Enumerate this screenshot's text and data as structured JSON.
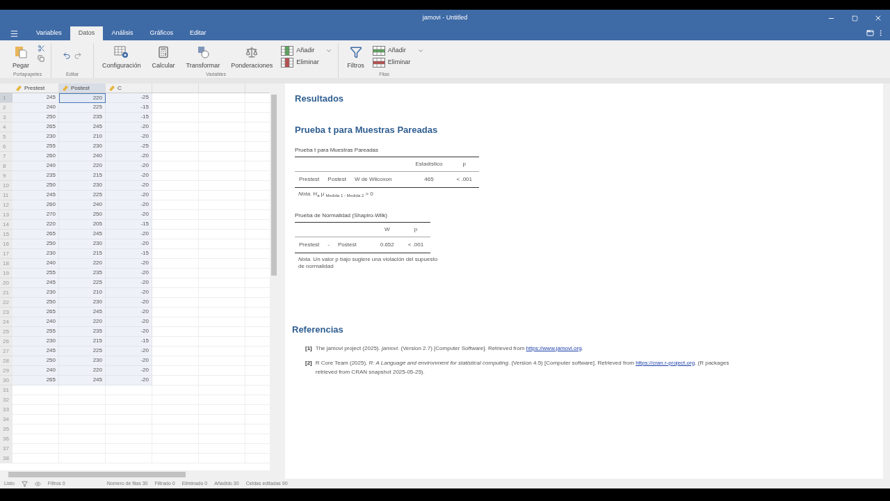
{
  "window": {
    "title": "jamovi - Untitled"
  },
  "tabs": [
    {
      "label": "Variables",
      "selected": false
    },
    {
      "label": "Datos",
      "selected": true
    },
    {
      "label": "Análisis",
      "selected": false
    },
    {
      "label": "Gráficos",
      "selected": false
    },
    {
      "label": "Editar",
      "selected": false
    }
  ],
  "ribbon": {
    "clipboard": {
      "label": "Portapapeles",
      "paste": "Pegar"
    },
    "edit": {
      "label": "Editar"
    },
    "variables": {
      "label": "Variables",
      "setup": "Configuración",
      "compute": "Calcular",
      "transform": "Transformar",
      "weights": "Ponderaciones",
      "add": "Añadir",
      "remove": "Eliminar"
    },
    "rows": {
      "label": "Filas",
      "filters": "Filtros",
      "add": "Añadir",
      "remove": "Eliminar"
    }
  },
  "spreadsheet": {
    "columns": [
      {
        "name": "Prestest",
        "selected": false
      },
      {
        "name": "Postest",
        "selected": true
      },
      {
        "name": "C",
        "selected": false
      }
    ],
    "rows": [
      {
        "number": "1",
        "selected": true,
        "cells": [
          "245",
          "220",
          "-25"
        ]
      },
      {
        "number": "2",
        "selected": false,
        "cells": [
          "240",
          "225",
          "-15"
        ]
      },
      {
        "number": "3",
        "selected": false,
        "cells": [
          "250",
          "235",
          "-15"
        ]
      },
      {
        "number": "4",
        "selected": false,
        "cells": [
          "265",
          "245",
          "-20"
        ]
      },
      {
        "number": "5",
        "selected": false,
        "cells": [
          "230",
          "210",
          "-20"
        ]
      },
      {
        "number": "6",
        "selected": false,
        "cells": [
          "255",
          "230",
          "-25"
        ]
      },
      {
        "number": "7",
        "selected": false,
        "cells": [
          "260",
          "240",
          "-20"
        ]
      },
      {
        "number": "8",
        "selected": false,
        "cells": [
          "240",
          "220",
          "-20"
        ]
      },
      {
        "number": "9",
        "selected": false,
        "cells": [
          "235",
          "215",
          "-20"
        ]
      },
      {
        "number": "10",
        "selected": false,
        "cells": [
          "250",
          "230",
          "-20"
        ]
      },
      {
        "number": "11",
        "selected": false,
        "cells": [
          "245",
          "225",
          "-20"
        ]
      },
      {
        "number": "12",
        "selected": false,
        "cells": [
          "260",
          "240",
          "-20"
        ]
      },
      {
        "number": "13",
        "selected": false,
        "cells": [
          "270",
          "250",
          "-20"
        ]
      },
      {
        "number": "14",
        "selected": false,
        "cells": [
          "220",
          "205",
          "-15"
        ]
      },
      {
        "number": "15",
        "selected": false,
        "cells": [
          "265",
          "245",
          "-20"
        ]
      },
      {
        "number": "16",
        "selected": false,
        "cells": [
          "250",
          "230",
          "-20"
        ]
      },
      {
        "number": "17",
        "selected": false,
        "cells": [
          "230",
          "215",
          "-15"
        ]
      },
      {
        "number": "18",
        "selected": false,
        "cells": [
          "240",
          "220",
          "-20"
        ]
      },
      {
        "number": "19",
        "selected": false,
        "cells": [
          "255",
          "235",
          "-20"
        ]
      },
      {
        "number": "20",
        "selected": false,
        "cells": [
          "245",
          "225",
          "-20"
        ]
      },
      {
        "number": "21",
        "selected": false,
        "cells": [
          "230",
          "210",
          "-20"
        ]
      },
      {
        "number": "22",
        "selected": false,
        "cells": [
          "250",
          "230",
          "-20"
        ]
      },
      {
        "number": "23",
        "selected": false,
        "cells": [
          "265",
          "245",
          "-20"
        ]
      },
      {
        "number": "24",
        "selected": false,
        "cells": [
          "240",
          "220",
          "-20"
        ]
      },
      {
        "number": "25",
        "selected": false,
        "cells": [
          "255",
          "235",
          "-20"
        ]
      },
      {
        "number": "26",
        "selected": false,
        "cells": [
          "230",
          "215",
          "-15"
        ]
      },
      {
        "number": "27",
        "selected": false,
        "cells": [
          "245",
          "225",
          "-20"
        ]
      },
      {
        "number": "28",
        "selected": false,
        "cells": [
          "250",
          "230",
          "-20"
        ]
      },
      {
        "number": "29",
        "selected": false,
        "cells": [
          "240",
          "220",
          "-20"
        ]
      },
      {
        "number": "30",
        "selected": false,
        "cells": [
          "265",
          "245",
          "-20"
        ]
      }
    ],
    "empty_row_numbers": [
      "31",
      "32",
      "33",
      "34",
      "35",
      "36",
      "37",
      "38"
    ]
  },
  "results": {
    "title": "Resultados",
    "analysis_title": "Prueba t para Muestras Pareadas",
    "tables": [
      {
        "title": "Prueba t para Muestras Pareadas",
        "header": [
          "Estadístico",
          "p"
        ],
        "rows": [
          [
            "Prestest",
            "Postest",
            "W de Wilcoxon",
            "465",
            "< .001"
          ]
        ],
        "note": "*Nota.* H$_{a}$ μ $_{Medida 1 - Medida 2}$ > 0"
      },
      {
        "title": "Prueba de Normalidad (Shapiro-Wilk)",
        "header": [
          "W",
          "p"
        ],
        "rows": [
          [
            "Prestest",
            "-",
            "Postest",
            "0.652",
            "< .001"
          ]
        ],
        "note": "*Nota.* Un valor p bajo sugiere una violación del supuesto de normalidad"
      }
    ],
    "references_title": "Referencias",
    "references": [
      {
        "number": "[1]",
        "text": "The jamovi project (2025). *jamovi*. (Version 2.7) [Computer Software]. Retrieved from ",
        "link": "https://www.jamovi.org",
        "after": "."
      },
      {
        "number": "[2]",
        "text": "R Core Team (2025). *R: A Language and environment for statistical computing*. (Version 4.5) [Computer software]. Retrieved from ",
        "link": "https://cran.r-project.org",
        "after": ". (R packages retrieved from CRAN snapshot 2025-05-25)."
      }
    ]
  },
  "status_bar": {
    "state": "Listo",
    "filters": "Filtros 0",
    "row_count": "Número de filas 30",
    "filtered": "Filtrado 0",
    "deleted": "Eliminado 0",
    "added": "Añadido 30",
    "edited": "Celdas editadas 90"
  }
}
